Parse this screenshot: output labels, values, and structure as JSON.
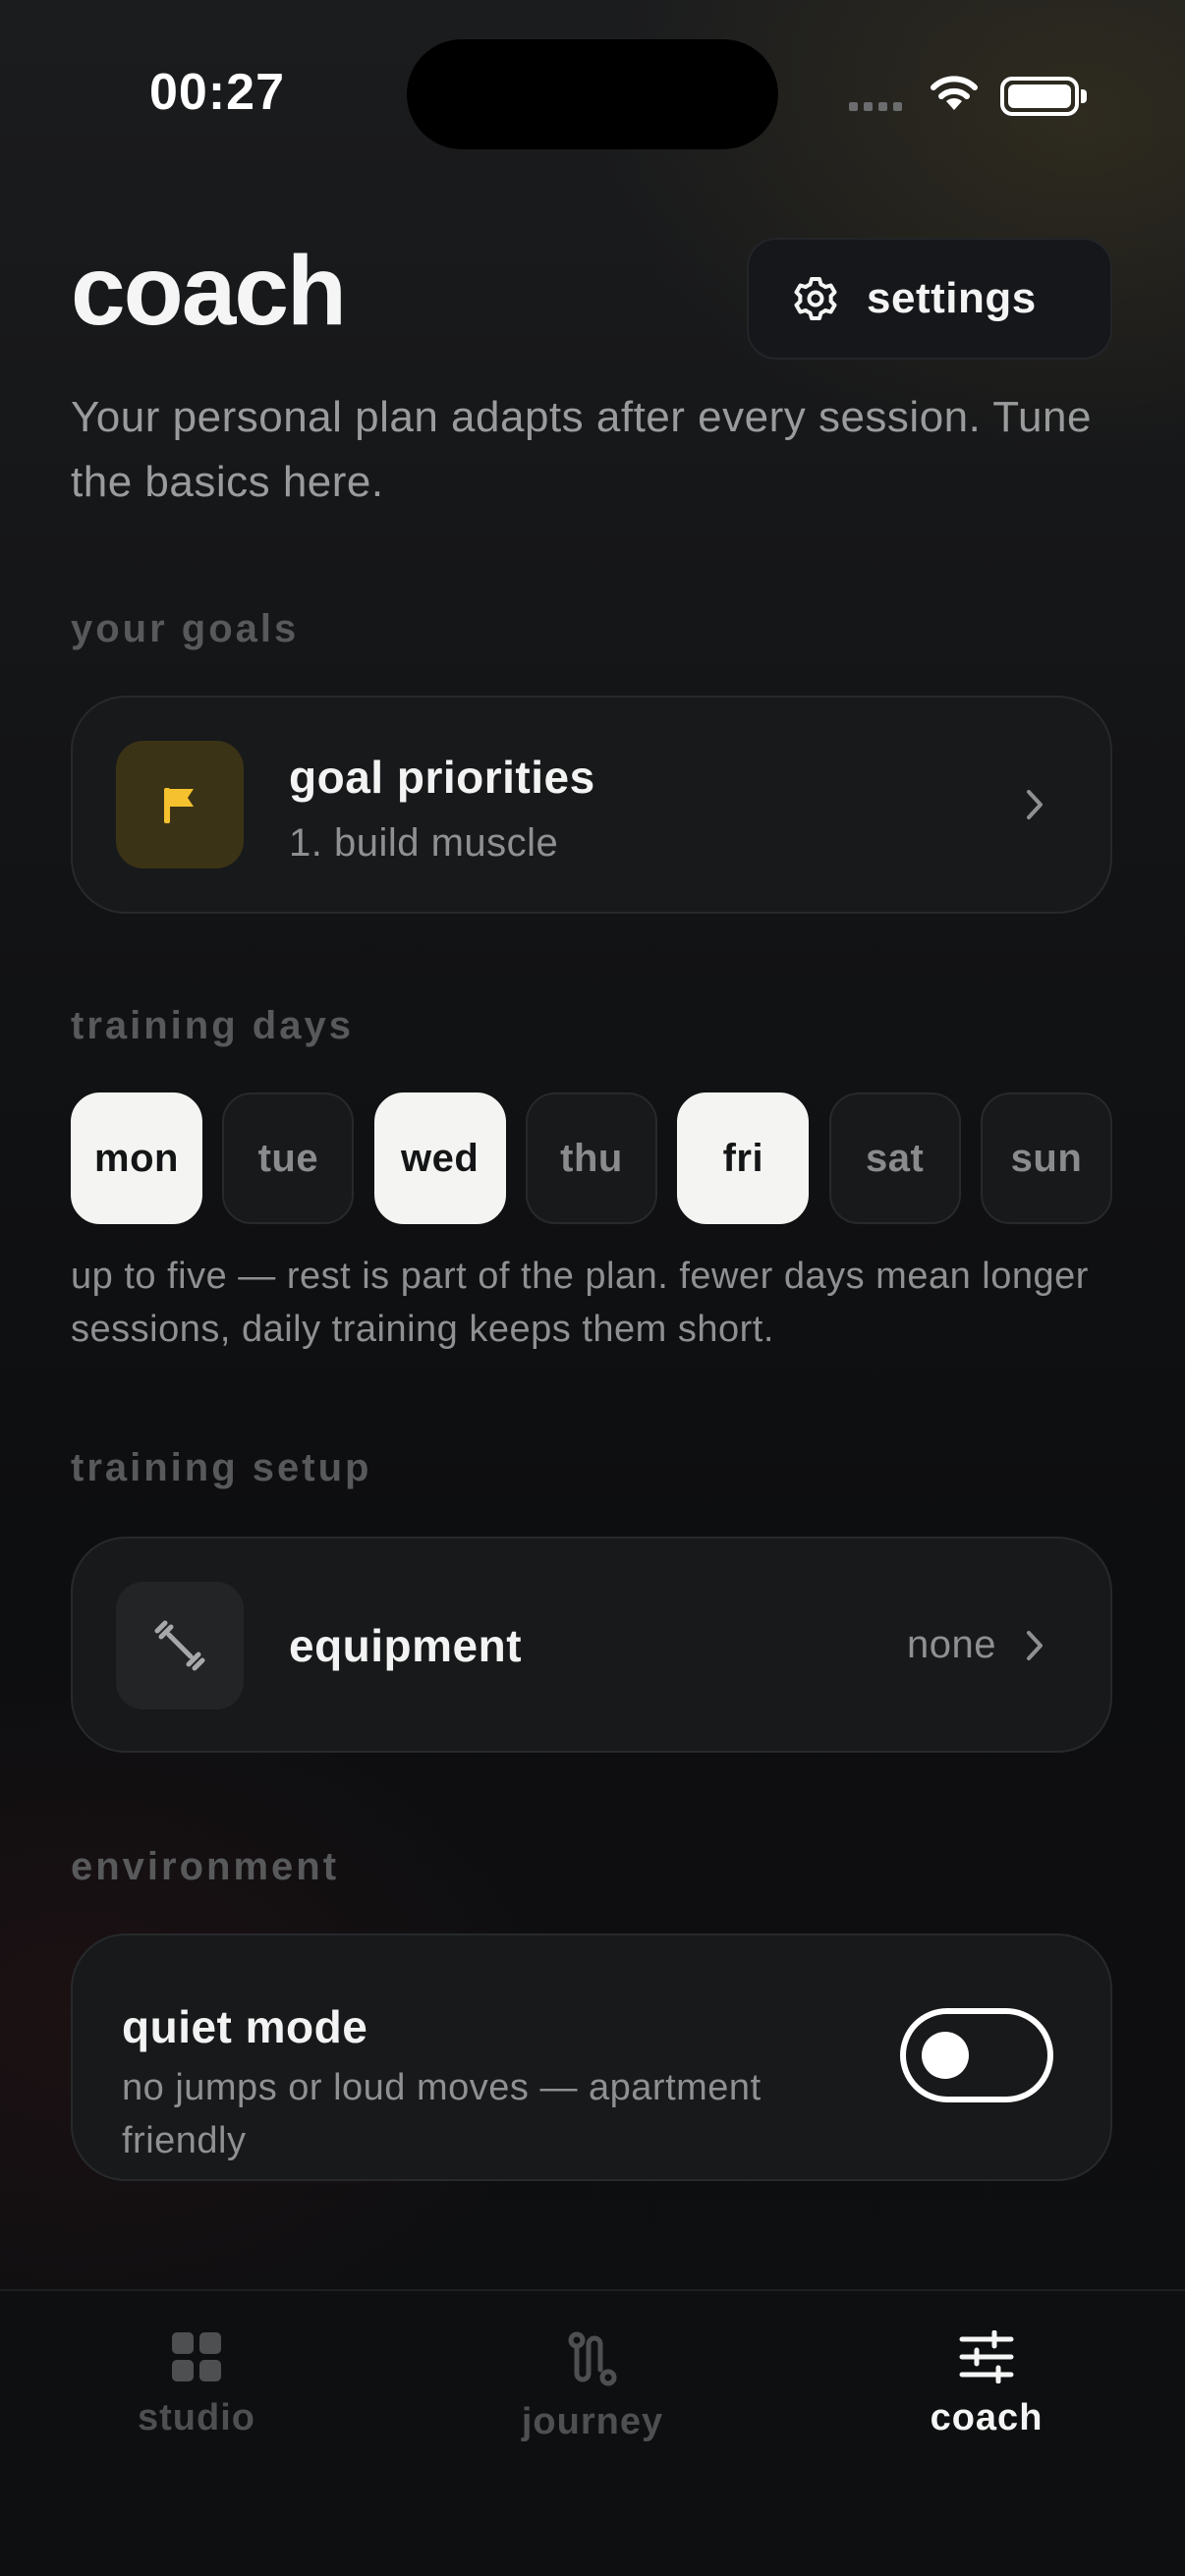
{
  "status_bar": {
    "time": "00:27"
  },
  "header": {
    "title": "coach",
    "settings_label": "settings",
    "subtitle": "Your personal plan adapts after every session. Tune the basics here."
  },
  "goals": {
    "section_label": "your goals",
    "title": "goal priorities",
    "subtitle": "1. build muscle",
    "accent_color": "#f5c12e"
  },
  "training_days": {
    "section_label": "training days",
    "days": [
      {
        "label": "mon",
        "selected": true
      },
      {
        "label": "tue",
        "selected": false
      },
      {
        "label": "wed",
        "selected": true
      },
      {
        "label": "thu",
        "selected": false
      },
      {
        "label": "fri",
        "selected": true
      },
      {
        "label": "sat",
        "selected": false
      },
      {
        "label": "sun",
        "selected": false
      }
    ],
    "note": "up to five — rest is part of the plan. fewer days mean longer sessions, daily training keeps them short."
  },
  "training_setup": {
    "section_label": "training setup",
    "title": "equipment",
    "value": "none"
  },
  "environment": {
    "section_label": "environment",
    "title": "quiet mode",
    "description": "no jumps or loud moves — apartment friendly",
    "enabled": false
  },
  "tabbar": {
    "tabs": [
      {
        "label": "studio",
        "icon": "grid-icon",
        "active": false
      },
      {
        "label": "journey",
        "icon": "route-icon",
        "active": false
      },
      {
        "label": "coach",
        "icon": "sliders-icon",
        "active": true
      }
    ]
  }
}
